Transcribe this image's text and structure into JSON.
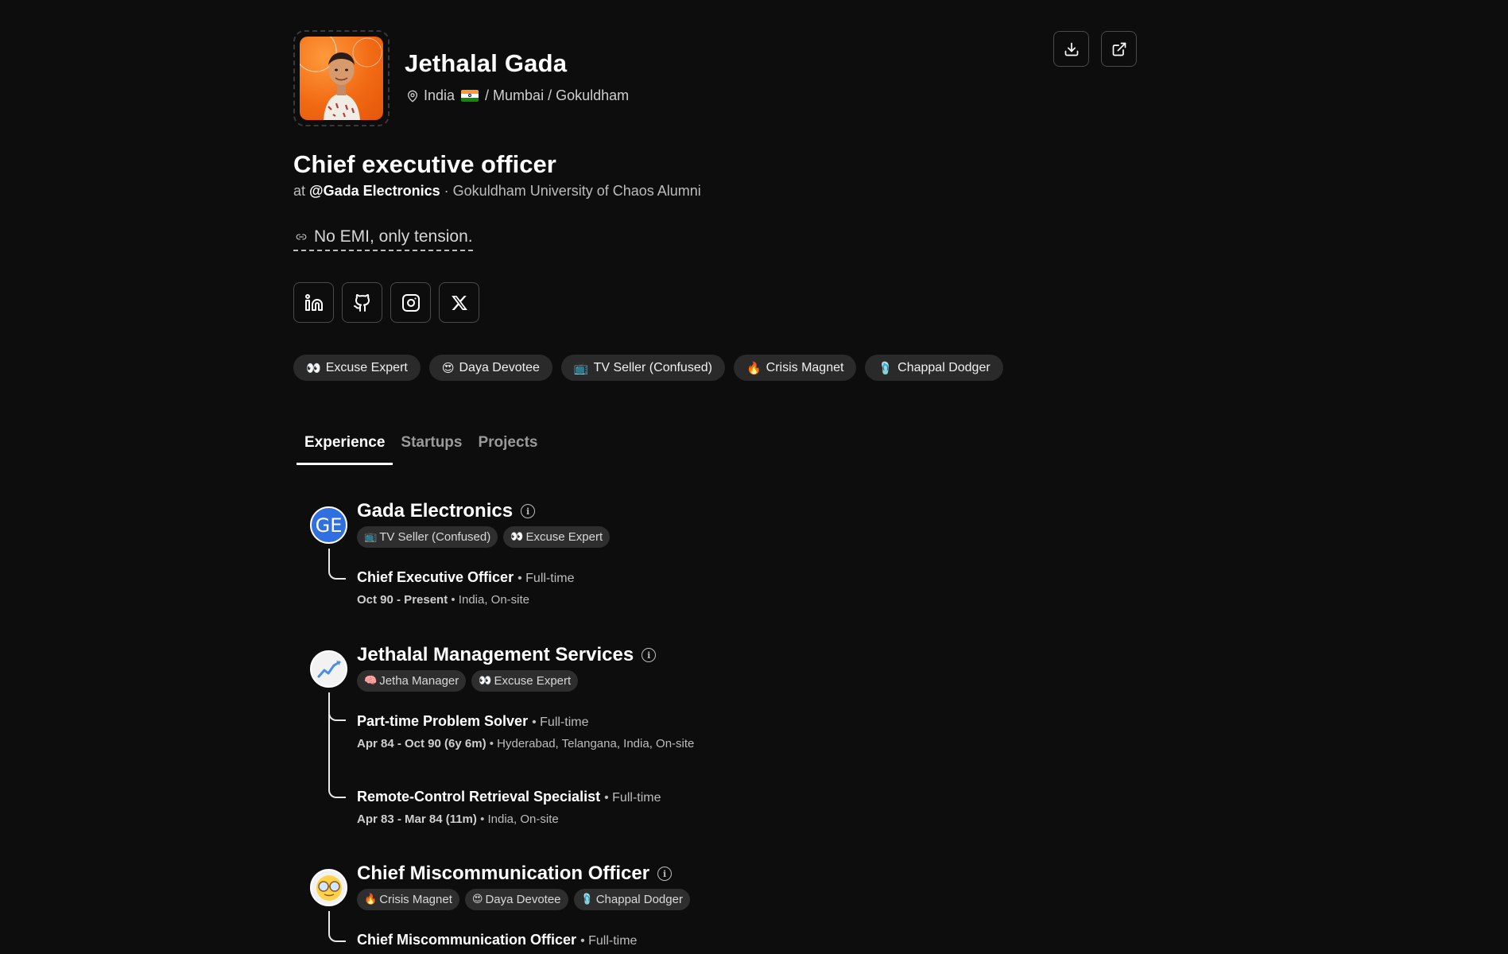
{
  "profile": {
    "name": "Jethalal Gada",
    "location": {
      "country": "India",
      "rest": "/ Mumbai / Gokuldham"
    },
    "role_title": "Chief executive officer",
    "role_at": "at",
    "company": "@Gada Electronics",
    "alumni": "· Gokuldham University of Chaos Alumni",
    "tagline": "No EMI, only tension."
  },
  "actions": {
    "download_icon": "download-icon",
    "share_icon": "external-link-icon"
  },
  "socials": [
    "linkedin-icon",
    "github-icon",
    "instagram-icon",
    "x-icon"
  ],
  "badges": [
    {
      "emoji": "👀",
      "label": "Excuse Expert"
    },
    {
      "emoji": "😍",
      "label": "Daya Devotee"
    },
    {
      "emoji": "📺",
      "label": "TV Seller (Confused)"
    },
    {
      "emoji": "🔥",
      "label": "Crisis Magnet"
    },
    {
      "emoji": "🩴",
      "label": "Chappal Dodger"
    }
  ],
  "tabs": [
    {
      "label": "Experience",
      "active": true
    },
    {
      "label": "Startups",
      "active": false
    },
    {
      "label": "Projects",
      "active": false
    }
  ],
  "experience": [
    {
      "name": "Gada Electronics",
      "logo_text": "GE",
      "logo_color": "#2f6fe0",
      "tags": [
        {
          "emoji": "📺",
          "label": "TV Seller (Confused)"
        },
        {
          "emoji": "👀",
          "label": "Excuse Expert"
        }
      ],
      "positions": [
        {
          "title": "Chief Executive Officer",
          "type": "• Full-time",
          "dates": "Oct 90 - Present",
          "place": "• India, On-site"
        }
      ]
    },
    {
      "name": "Jethalal Management Services",
      "logo_text": "",
      "logo_color": "#f2f2f2",
      "tags": [
        {
          "emoji": "🧠",
          "label": "Jetha Manager"
        },
        {
          "emoji": "👀",
          "label": "Excuse Expert"
        }
      ],
      "positions": [
        {
          "title": "Part-time Problem Solver",
          "type": "• Full-time",
          "dates": "Apr 84 - Oct 90 (6y 6m)",
          "place": "• Hyderabad, Telangana, India, On-site"
        },
        {
          "title": "Remote-Control Retrieval Specialist",
          "type": "• Full-time",
          "dates": "Apr 83 - Mar 84 (11m)",
          "place": "• India, On-site"
        }
      ]
    },
    {
      "name": "Chief Miscommunication Officer",
      "logo_text": "",
      "logo_color": "#f2f2f2",
      "tags": [
        {
          "emoji": "🔥",
          "label": "Crisis Magnet"
        },
        {
          "emoji": "😍",
          "label": "Daya Devotee"
        },
        {
          "emoji": "🩴",
          "label": "Chappal Dodger"
        }
      ],
      "positions": [
        {
          "title": "Chief Miscommunication Officer",
          "type": "• Full-time",
          "dates": "",
          "place": ""
        }
      ]
    }
  ]
}
